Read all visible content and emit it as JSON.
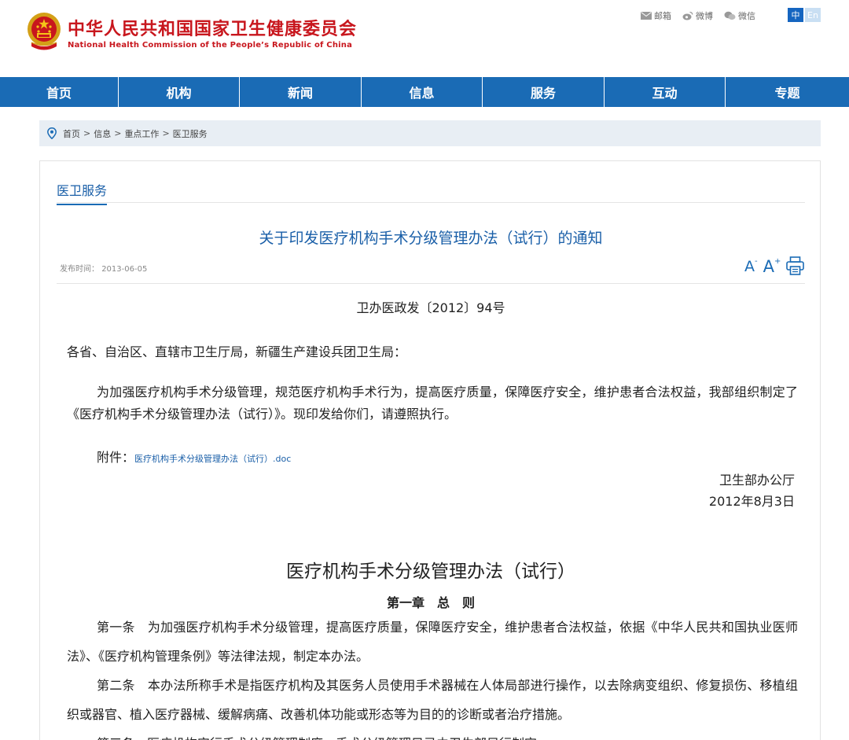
{
  "header": {
    "site_name_cn": "中华人民共和国国家卫生健康委员会",
    "site_name_en": "National Health Commission of the People’s Republic of China",
    "emblem_icon": "national-emblem-icon",
    "links": [
      {
        "label": "邮箱",
        "icon": "mail-icon"
      },
      {
        "label": "微博",
        "icon": "weibo-icon"
      },
      {
        "label": "微信",
        "icon": "wechat-icon"
      }
    ],
    "lang": {
      "zh": "中",
      "en": "En"
    }
  },
  "nav": {
    "items": [
      {
        "label": "首页"
      },
      {
        "label": "机构"
      },
      {
        "label": "新闻"
      },
      {
        "label": "信息"
      },
      {
        "label": "服务"
      },
      {
        "label": "互动"
      },
      {
        "label": "专题"
      }
    ]
  },
  "breadcrumb": {
    "icon": "location-pin-icon",
    "items": [
      "首页",
      "信息",
      "重点工作",
      "医卫服务"
    ],
    "separator": ">"
  },
  "section": {
    "title": "医卫服务"
  },
  "article": {
    "title": "关于印发医疗机构手术分级管理办法（试行）的通知",
    "publish_label": "发布时间：",
    "publish_date": "2013-06-05",
    "tools": {
      "font_smaller": "A",
      "font_larger": "A",
      "minus": "-",
      "plus": "+",
      "print_icon": "printer-icon"
    },
    "doc_number": "卫办医政发〔2012〕94号",
    "addressee": "各省、自治区、直辖市卫生厅局，新疆生产建设兵团卫生局：",
    "paragraph": "为加强医疗机构手术分级管理，规范医疗机构手术行为，提高医疗质量，保障医疗安全，维护患者合法权益，我部组织制定了《医疗机构手术分级管理办法（试行）》。现印发给你们，请遵照执行。",
    "attachment_label": "附件：",
    "attachment_link": "医疗机构手术分级管理办法（试行）.doc",
    "sign_org": "卫生部办公厅",
    "sign_date": "2012年8月3日",
    "measure_title": "医疗机构手术分级管理办法（试行）",
    "chapter": "第一章　总　则",
    "articles": [
      "第一条　为加强医疗机构手术分级管理，提高医疗质量，保障医疗安全，维护患者合法权益，依据《中华人民共和国执业医师法》、《医疗机构管理条例》等法律法规，制定本办法。",
      "第二条　本办法所称手术是指医疗机构及其医务人员使用手术器械在人体局部进行操作，以去除病变组织、修复损伤、移植组织或器官、植入医疗器械、缓解病痛、改善机体功能或形态等为目的的诊断或者治疗措施。",
      "第三条　医疗机构实行手术分级管理制度。手术分级管理目录由卫生部另行制定。"
    ]
  },
  "colors": {
    "brand_red": "#c8161d",
    "nav_blue": "#1a6bb5",
    "link_blue": "#1a5fa8",
    "breadcrumb_bg": "#e8eef4"
  }
}
